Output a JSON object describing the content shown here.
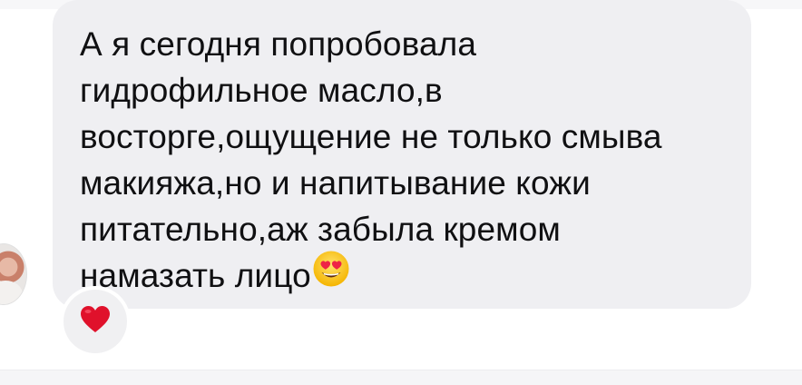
{
  "message": {
    "lines": [
      "А я сегодня попробовала",
      "гидрофильное масло,в",
      "восторге,ощущение не только смыва",
      "макияжа,но и напитывание кожи",
      "питательно,аж забыла кремом",
      "намазать лицо"
    ],
    "emoji": "smiling-face-with-heart-eyes"
  },
  "reaction": {
    "emoji": "red-heart",
    "color": "#e0112b"
  },
  "colors": {
    "bubble": "#efeff2",
    "text": "#101012"
  }
}
